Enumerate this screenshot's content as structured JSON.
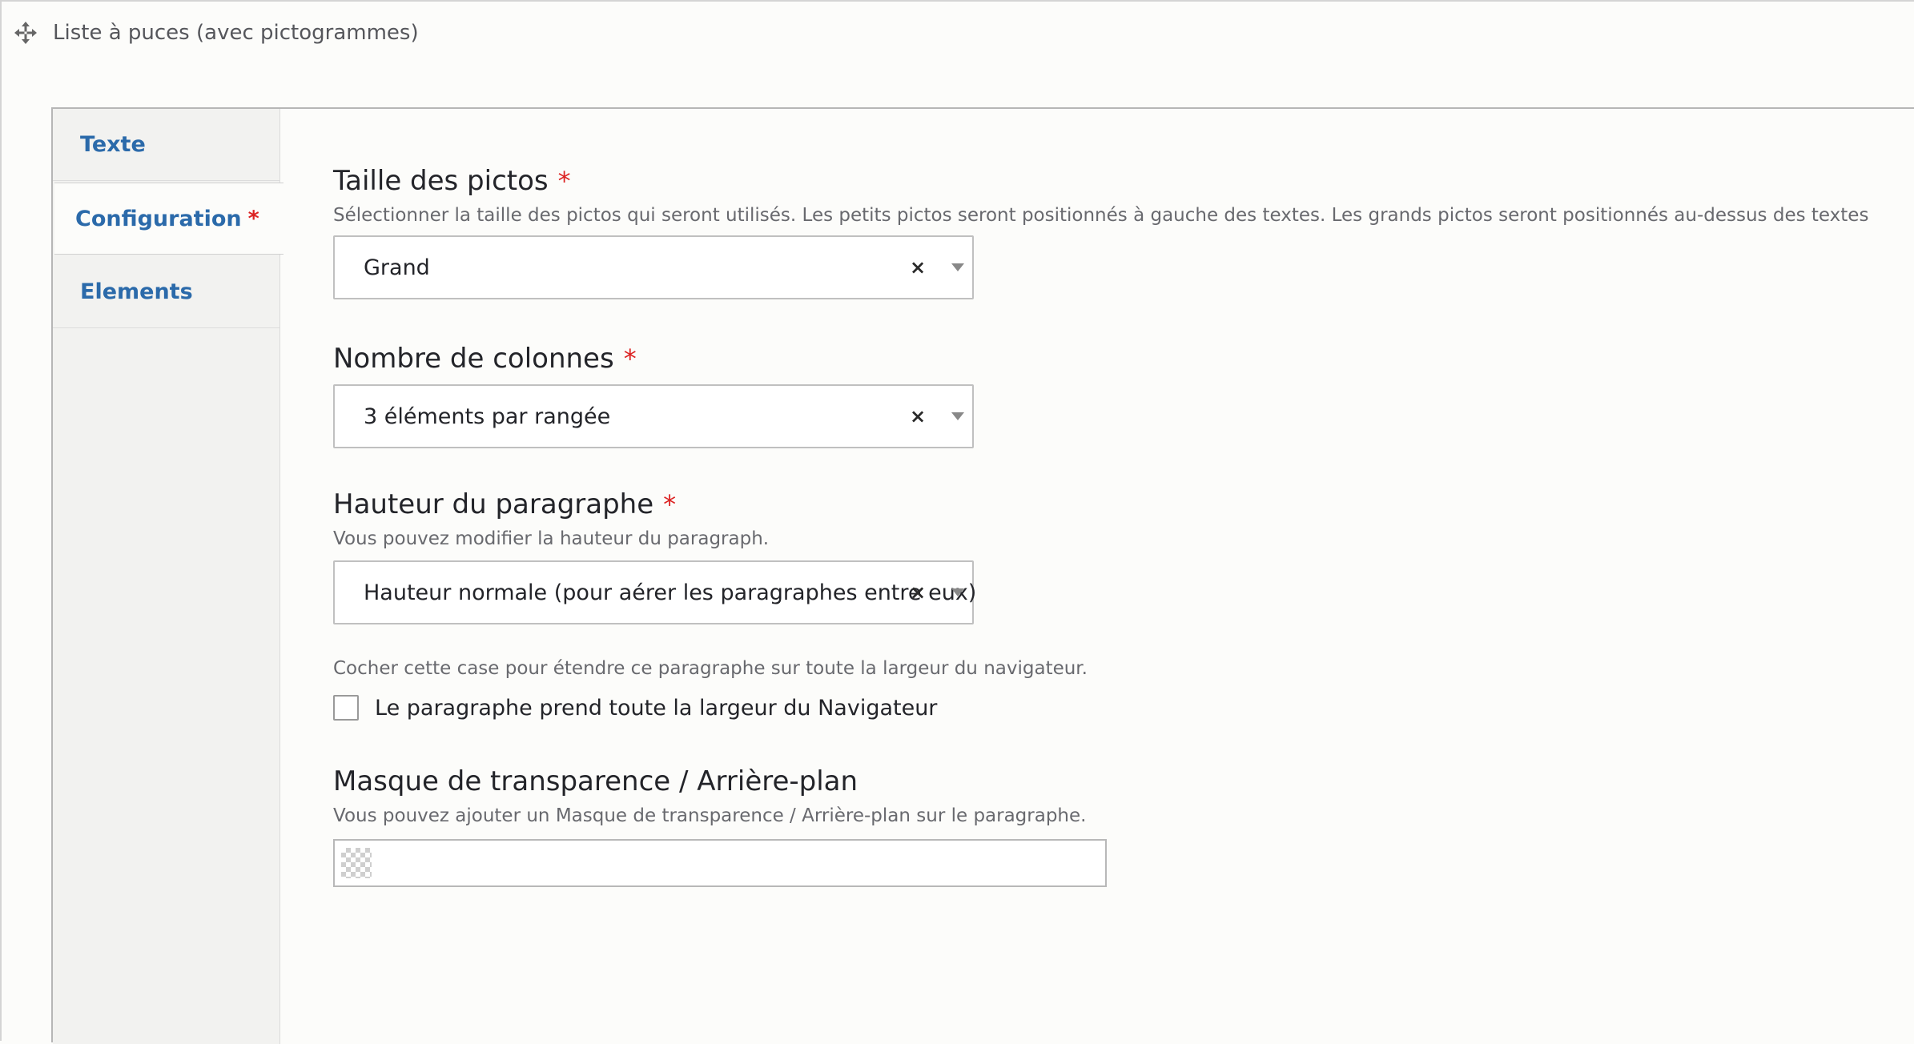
{
  "paragraph": {
    "title": "Liste à puces (avec pictogrammes)",
    "move_icon": "move-arrows-icon"
  },
  "tabs": [
    {
      "label": "Texte",
      "active": false,
      "required": false
    },
    {
      "label": "Configuration",
      "active": true,
      "required": true
    },
    {
      "label": "Elements",
      "active": false,
      "required": false
    }
  ],
  "required_marker": "*",
  "fields": {
    "taille": {
      "label": "Taille des pictos",
      "description": "Sélectionner la taille des pictos qui seront utilisés. Les petits pictos seront positionnés à gauche des textes. Les grands pictos seront positionnés au-dessus des textes",
      "value": "Grand",
      "clear": "×"
    },
    "colonnes": {
      "label": "Nombre de colonnes",
      "value": "3 éléments par rangée",
      "clear": "×"
    },
    "hauteur": {
      "label": "Hauteur du paragraphe",
      "description": "Vous pouvez modifier la hauteur du paragraph.",
      "value": "Hauteur normale (pour aérer les paragraphes entre eux)",
      "clear": "×"
    },
    "largeur": {
      "description": "Cocher cette case pour étendre ce paragraphe sur toute la largeur du navigateur.",
      "checkbox_label": "Le paragraphe prend toute la largeur du Navigateur",
      "checked": false
    },
    "masque": {
      "label": "Masque de transparence / Arrière-plan",
      "description": "Vous pouvez ajouter un Masque de transparence / Arrière-plan sur le paragraphe.",
      "swatch": "transparent-swatch-icon"
    }
  },
  "colors": {
    "tab_link": "#2b6aaa",
    "required": "#dc2323",
    "background": "#fcfcfa",
    "sidebar": "#f2f2f0"
  }
}
